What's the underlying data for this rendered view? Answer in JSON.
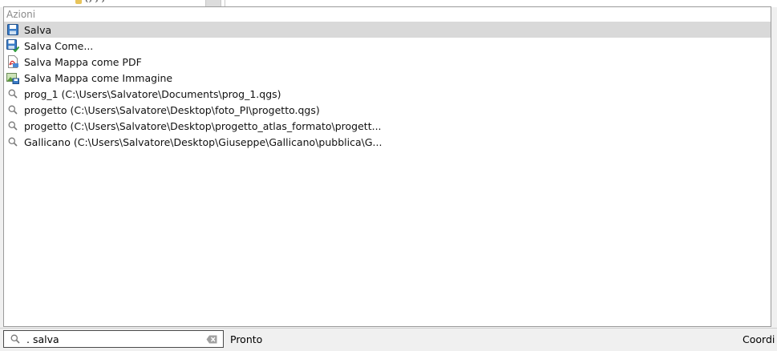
{
  "background": {
    "partial_text": "‹› › ›"
  },
  "locator": {
    "group_label": "Azioni",
    "results": [
      {
        "label": "Salva",
        "icon": "save-icon",
        "selected": true
      },
      {
        "label": "Salva Come...",
        "icon": "save-as-icon",
        "selected": false
      },
      {
        "label": "Salva Mappa come PDF",
        "icon": "pdf-icon",
        "selected": false
      },
      {
        "label": "Salva Mappa come Immagine",
        "icon": "image-save-icon",
        "selected": false
      },
      {
        "label": "prog_1 (C:\\Users\\Salvatore\\Documents\\prog_1.qgs)",
        "icon": "search-icon",
        "selected": false
      },
      {
        "label": "progetto (C:\\Users\\Salvatore\\Desktop\\foto_PI\\progetto.qgs)",
        "icon": "search-icon",
        "selected": false
      },
      {
        "label": "progetto (C:\\Users\\Salvatore\\Desktop\\progetto_atlas_formato\\progett...",
        "icon": "search-icon",
        "selected": false
      },
      {
        "label": "Gallicano (C:\\Users\\Salvatore\\Desktop\\Giuseppe\\Gallicano\\pubblica\\G...",
        "icon": "search-icon",
        "selected": false
      }
    ]
  },
  "statusbar": {
    "search_value": ". salva",
    "message": "Pronto",
    "coord_label": "Coordi"
  },
  "colors": {
    "selected_row": "#d9d9d9",
    "group_label": "#8a8a8a",
    "save_blue": "#2f6db5"
  }
}
